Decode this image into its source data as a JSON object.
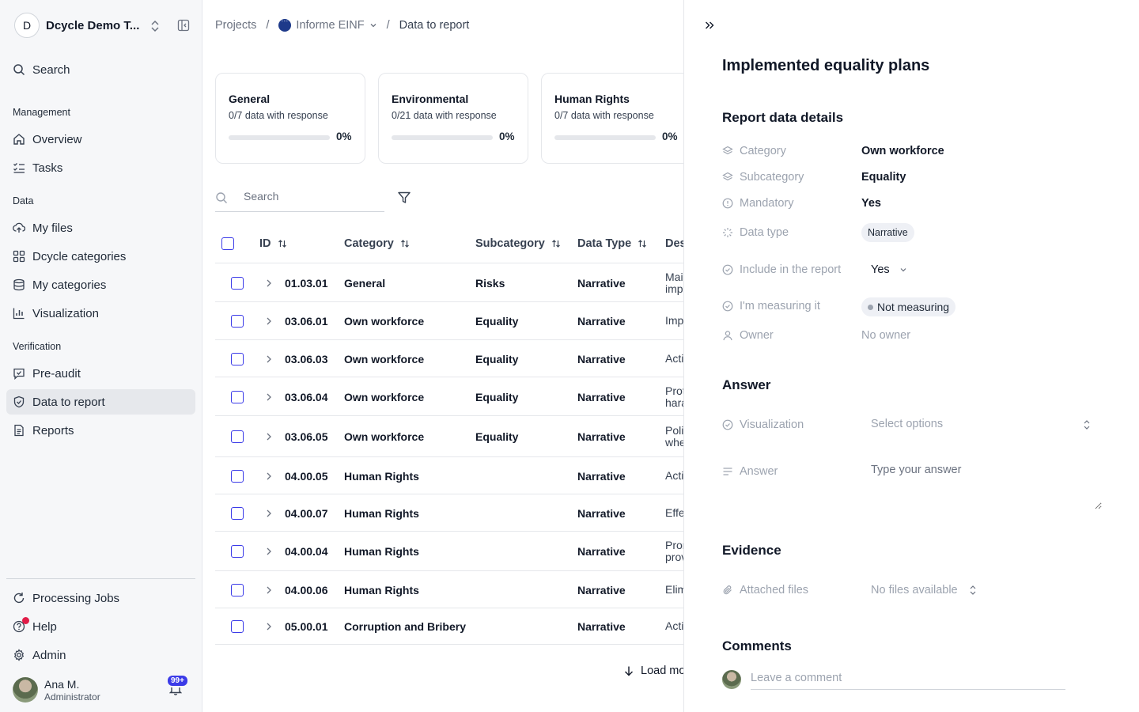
{
  "org": {
    "initial": "D",
    "name": "Dcycle Demo T..."
  },
  "sidebar": {
    "search": "Search",
    "sections": {
      "management": "Management",
      "data": "Data",
      "verification": "Verification"
    },
    "items": {
      "overview": "Overview",
      "tasks": "Tasks",
      "my_files": "My files",
      "dcycle_categories": "Dcycle categories",
      "my_categories": "My categories",
      "visualization": "Visualization",
      "pre_audit": "Pre-audit",
      "data_to_report": "Data to report",
      "reports": "Reports",
      "processing_jobs": "Processing Jobs",
      "help": "Help",
      "admin": "Admin"
    },
    "user": {
      "name": "Ana M.",
      "role": "Administrator",
      "notifications": "99+"
    }
  },
  "breadcrumb": {
    "projects": "Projects",
    "project": "Informe EINF",
    "current": "Data to report"
  },
  "cards": [
    {
      "title": "General",
      "subtitle": "0/7 data with response",
      "percent": "0%",
      "progress": 0
    },
    {
      "title": "Environmental",
      "subtitle": "0/21 data with response",
      "percent": "0%",
      "progress": 0
    },
    {
      "title": "Human Rights",
      "subtitle": "0/7 data with response",
      "percent": "0%",
      "progress": 0
    }
  ],
  "table": {
    "search_placeholder": "Search",
    "headers": {
      "id": "ID",
      "category": "Category",
      "subcategory": "Subcategory",
      "data_type": "Data Type",
      "description": "Des"
    },
    "rows": [
      {
        "id": "01.03.01",
        "category": "General",
        "subcategory": "Risks",
        "data_type": "Narrative",
        "desc": "Mai impı"
      },
      {
        "id": "03.06.01",
        "category": "Own workforce",
        "subcategory": "Equality",
        "data_type": "Narrative",
        "desc": "Imp"
      },
      {
        "id": "03.06.03",
        "category": "Own workforce",
        "subcategory": "Equality",
        "data_type": "Narrative",
        "desc": "Acti"
      },
      {
        "id": "03.06.04",
        "category": "Own workforce",
        "subcategory": "Equality",
        "data_type": "Narrative",
        "desc": "Prot hara"
      },
      {
        "id": "03.06.05",
        "category": "Own workforce",
        "subcategory": "Equality",
        "data_type": "Narrative",
        "desc": "Poli whe"
      },
      {
        "id": "04.00.05",
        "category": "Human Rights",
        "subcategory": "",
        "data_type": "Narrative",
        "desc": "Acti"
      },
      {
        "id": "04.00.07",
        "category": "Human Rights",
        "subcategory": "",
        "data_type": "Narrative",
        "desc": "Effe"
      },
      {
        "id": "04.00.04",
        "category": "Human Rights",
        "subcategory": "",
        "data_type": "Narrative",
        "desc": "Pron prov"
      },
      {
        "id": "04.00.06",
        "category": "Human Rights",
        "subcategory": "",
        "data_type": "Narrative",
        "desc": "Elim"
      },
      {
        "id": "05.00.01",
        "category": "Corruption and Bribery",
        "subcategory": "",
        "data_type": "Narrative",
        "desc": "Acti"
      }
    ],
    "load_more": "Load mo"
  },
  "panel": {
    "title": "Implemented equality plans",
    "details_heading": "Report data details",
    "labels": {
      "category": "Category",
      "subcategory": "Subcategory",
      "mandatory": "Mandatory",
      "data_type": "Data type",
      "include": "Include in the report",
      "measuring": "I'm measuring it",
      "owner": "Owner",
      "visualization": "Visualization",
      "answer": "Answer",
      "attached_files": "Attached files"
    },
    "values": {
      "category": "Own workforce",
      "subcategory": "Equality",
      "mandatory": "Yes",
      "data_type": "Narrative",
      "include": "Yes",
      "measuring": "Not measuring",
      "owner": "No owner"
    },
    "answer_heading": "Answer",
    "visualization_placeholder": "Select options",
    "answer_placeholder": "Type your answer",
    "evidence_heading": "Evidence",
    "files_value": "No files available",
    "comments_heading": "Comments",
    "comment_placeholder": "Leave a comment"
  }
}
